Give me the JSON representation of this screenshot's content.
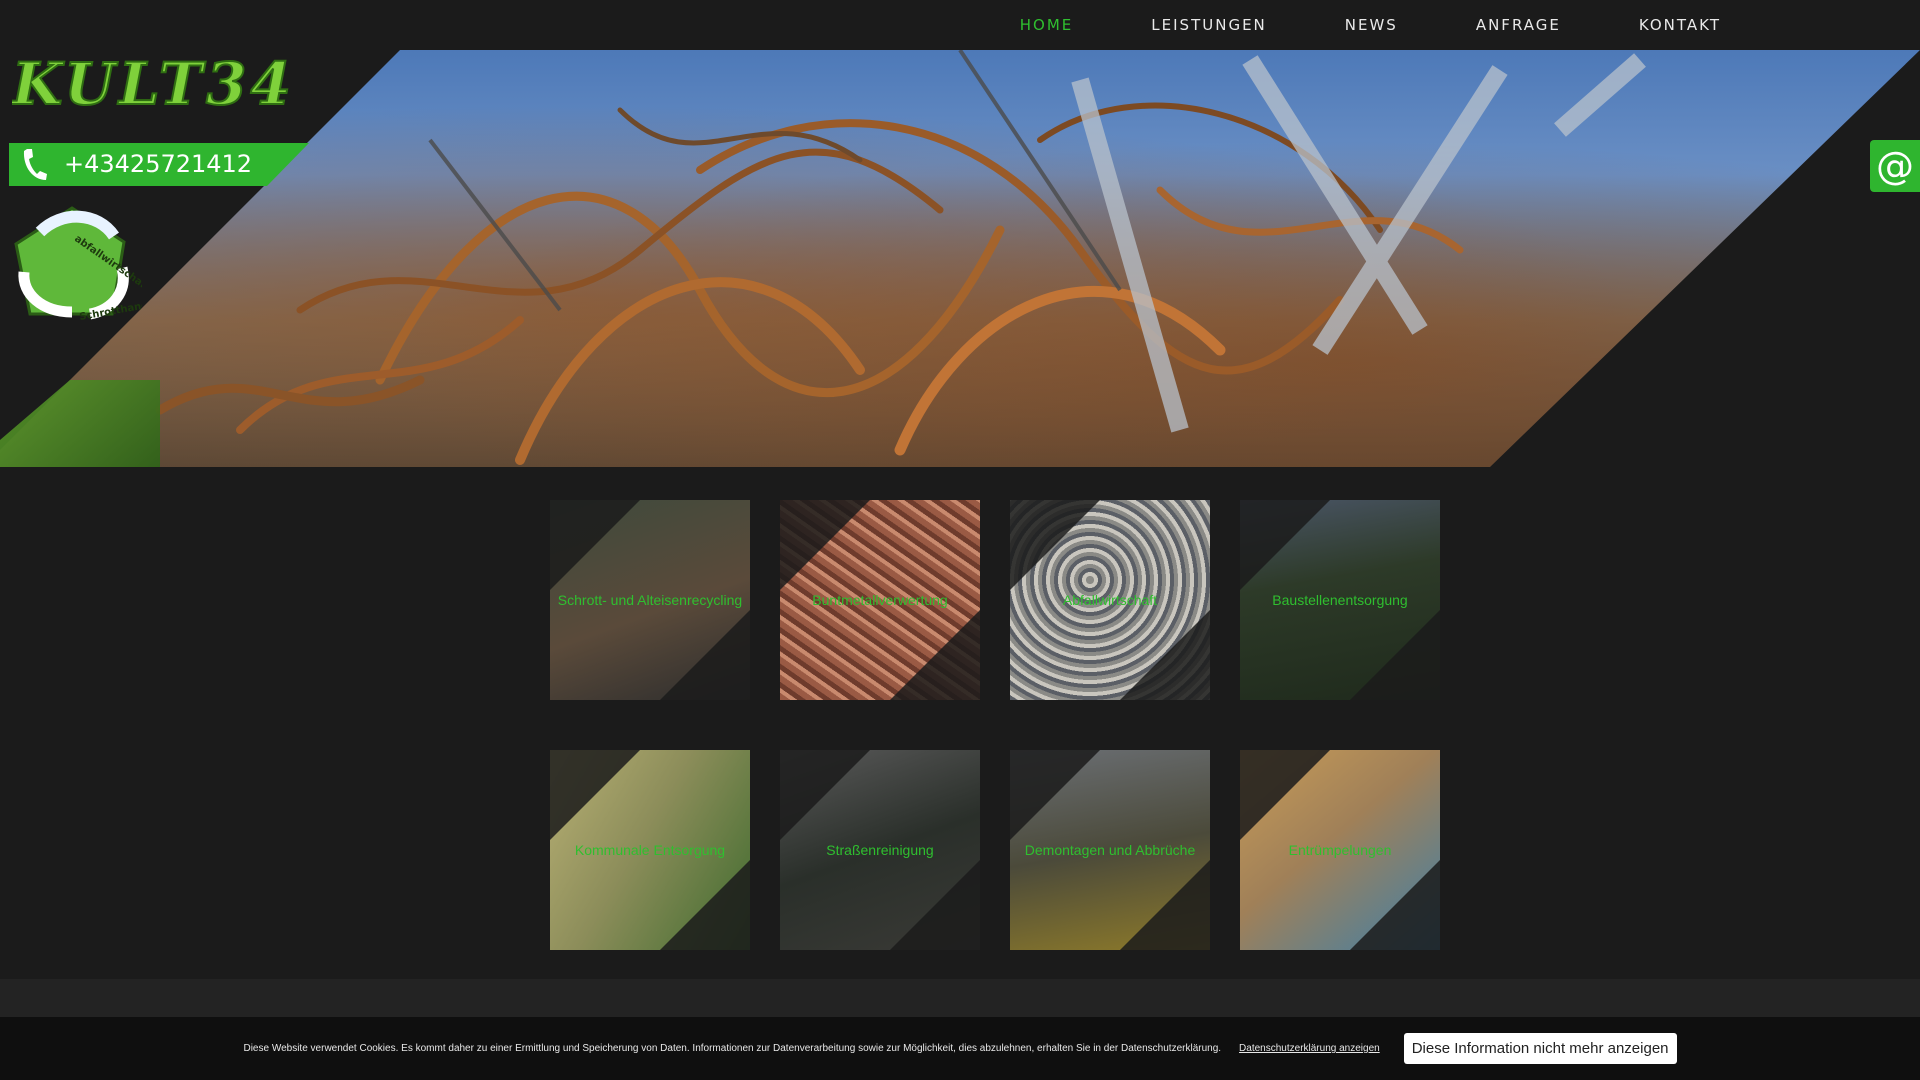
{
  "nav": {
    "items": [
      {
        "label": "HOME",
        "active": true
      },
      {
        "label": "LEISTUNGEN",
        "active": false
      },
      {
        "label": "NEWS",
        "active": false
      },
      {
        "label": "ANFRAGE",
        "active": false
      },
      {
        "label": "KONTAKT",
        "active": false
      }
    ]
  },
  "brand": {
    "logo_text": "KULT34",
    "phone": "+43425721412",
    "badge_text_top": "abfallwirtschaft",
    "badge_text_bottom": "Schrotthandel",
    "accent_color": "#2fb52f"
  },
  "email_tab": {
    "icon": "at-sign-icon",
    "glyph": "@"
  },
  "services": [
    {
      "label": "Schrott- und Alteisenrecycling"
    },
    {
      "label": "Buntmetallverwertung"
    },
    {
      "label": "Abfallwirtschaft"
    },
    {
      "label": "Baustellenentsorgung"
    },
    {
      "label": "Kommunale Entsorgung"
    },
    {
      "label": "Straßenreinigung"
    },
    {
      "label": "Demontagen und Abbrüche"
    },
    {
      "label": "Entrümpelungen"
    }
  ],
  "cookie": {
    "text": "Diese Website verwendet Cookies. Es kommt daher zu einer Ermittlung und Speicherung von Daten. Informationen zur Datenverarbeitung sowie zur Möglichkeit, dies abzulehnen, erhalten Sie in der Datenschutzerklärung.",
    "link": "Datenschutzerklärung anzeigen",
    "button": "Diese Information nicht mehr anzeigen"
  }
}
